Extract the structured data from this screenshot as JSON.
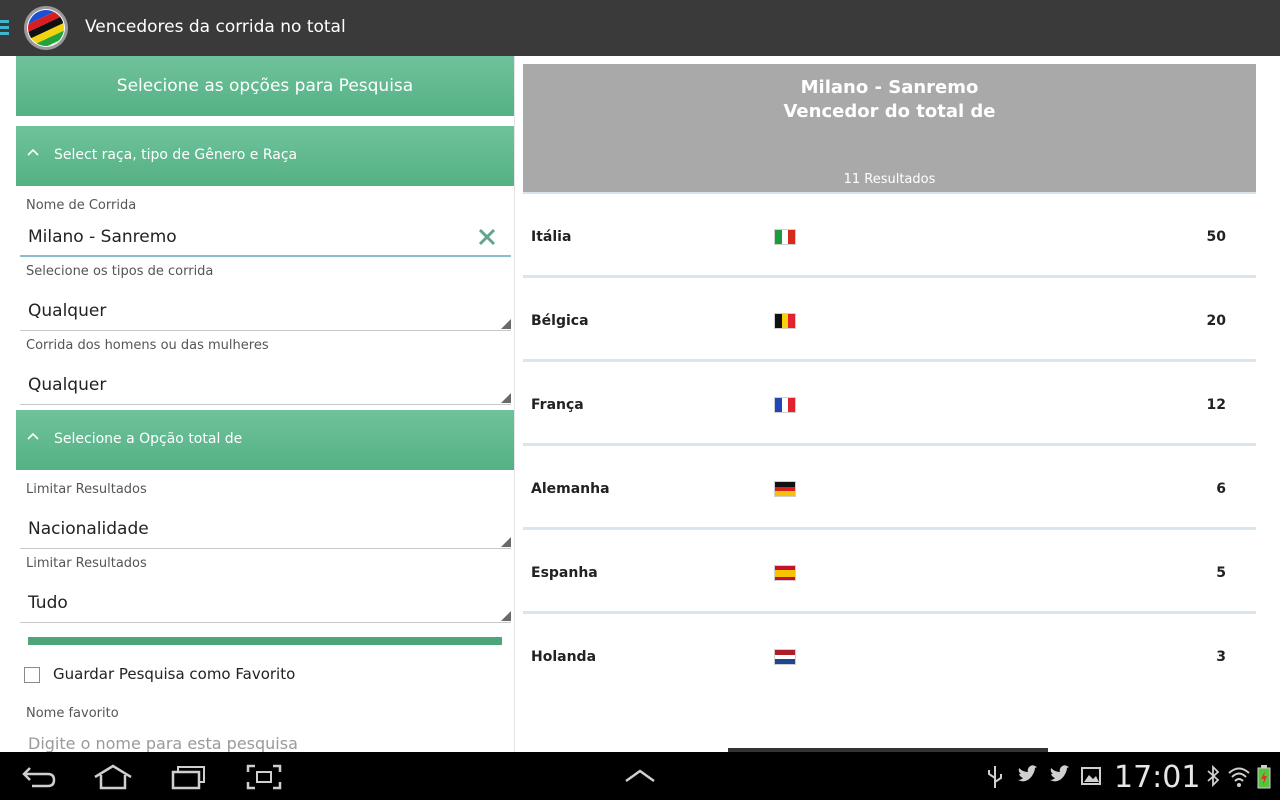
{
  "app": {
    "title": "Vencedores da corrida no total"
  },
  "search_panel": {
    "header": "Selecione as opções para Pesquisa",
    "section_race": {
      "label": "Select raça, tipo de Gênero e Raça"
    },
    "race_name": {
      "label": "Nome de Corrida",
      "value": "Milano - Sanremo"
    },
    "race_type": {
      "label": "Selecione os tipos de corrida",
      "value": "Qualquer"
    },
    "gender": {
      "label": "Corrida dos homens ou das mulheres",
      "value": "Qualquer"
    },
    "section_total": {
      "label": "Selecione a Opção total de"
    },
    "limit_1": {
      "label": "Limitar Resultados",
      "value": "Nacionalidade"
    },
    "limit_2": {
      "label": "Limitar Resultados",
      "value": "Tudo"
    },
    "progress": 1.0,
    "save_favorite": {
      "label": "Guardar Pesquisa como Favorito",
      "checked": false
    },
    "favorite_name": {
      "label": "Nome favorito",
      "placeholder": "Digite o nome para esta pesquisa"
    }
  },
  "results": {
    "title_line1": "Milano - Sanremo",
    "title_line2": "Vencedor do total de",
    "count": "11 Resultados",
    "rows": [
      {
        "country": "Itália",
        "flag": "italy-flag",
        "wins": "50"
      },
      {
        "country": "Bélgica",
        "flag": "belgium-flag",
        "wins": "20"
      },
      {
        "country": "França",
        "flag": "france-flag",
        "wins": "12"
      },
      {
        "country": "Alemanha",
        "flag": "germany-flag",
        "wins": "6"
      },
      {
        "country": "Espanha",
        "flag": "spain-flag",
        "wins": "5"
      },
      {
        "country": "Holanda",
        "flag": "netherlands-flag",
        "wins": "3"
      }
    ]
  },
  "system_bar": {
    "clock": "17:01"
  },
  "colors": {
    "actionbar": "#3a3a3a",
    "section_green": "#5fb88d",
    "results_header": "#a9a9a9",
    "progress": "#4da57a"
  }
}
